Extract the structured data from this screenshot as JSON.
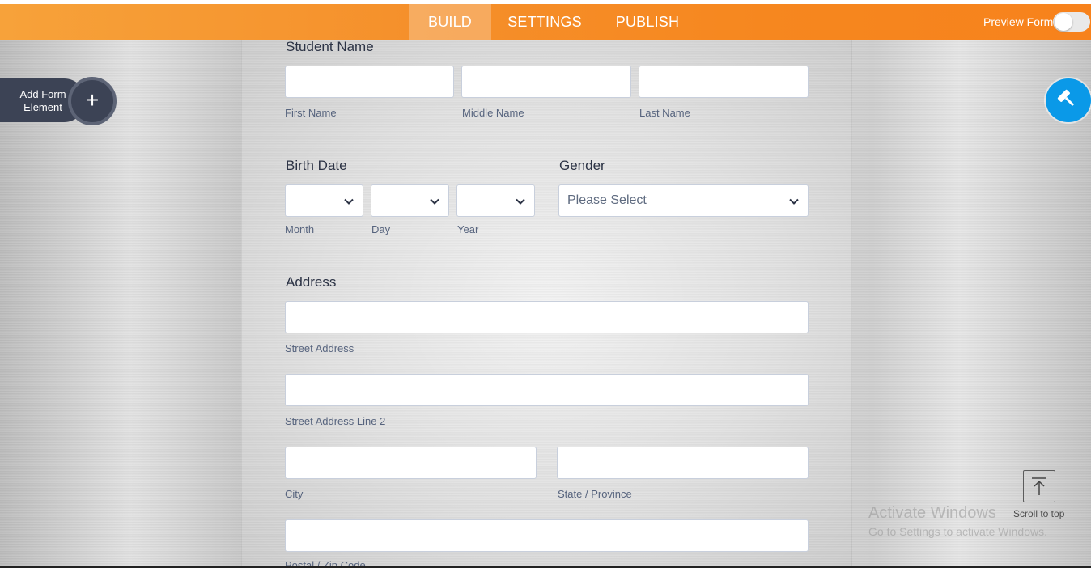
{
  "nav": {
    "tabs": [
      {
        "label": "BUILD",
        "active": true
      },
      {
        "label": "SETTINGS",
        "active": false
      },
      {
        "label": "PUBLISH",
        "active": false
      }
    ],
    "preview_label": "Preview Form",
    "preview_on": false
  },
  "sidebar": {
    "add_element_label": "Add Form Element",
    "add_icon": "plus-icon",
    "designer_icon": "paint-roller-icon"
  },
  "form": {
    "student_name": {
      "label": "Student Name",
      "first": {
        "value": "",
        "sublabel": "First Name"
      },
      "middle": {
        "value": "",
        "sublabel": "Middle Name"
      },
      "last": {
        "value": "",
        "sublabel": "Last Name"
      }
    },
    "birth_date": {
      "label": "Birth Date",
      "month": {
        "value": "",
        "sublabel": "Month"
      },
      "day": {
        "value": "",
        "sublabel": "Day"
      },
      "year": {
        "value": "",
        "sublabel": "Year"
      }
    },
    "gender": {
      "label": "Gender",
      "selected": "Please Select"
    },
    "address": {
      "label": "Address",
      "street": {
        "value": "",
        "sublabel": "Street Address"
      },
      "street2": {
        "value": "",
        "sublabel": "Street Address Line 2"
      },
      "city": {
        "value": "",
        "sublabel": "City"
      },
      "state": {
        "value": "",
        "sublabel": "State / Province"
      },
      "postal": {
        "value": "",
        "sublabel": "Postal / Zip Code"
      }
    }
  },
  "scroll_top": {
    "label": "Scroll to top",
    "icon": "arrow-up-to-line-icon"
  },
  "watermark": {
    "line1": "Activate Windows",
    "line2": "Go to Settings to activate Windows."
  },
  "colors": {
    "nav_orange": "#f6871f",
    "dark_button": "#3c4355",
    "designer_blue": "#0a99e8"
  }
}
